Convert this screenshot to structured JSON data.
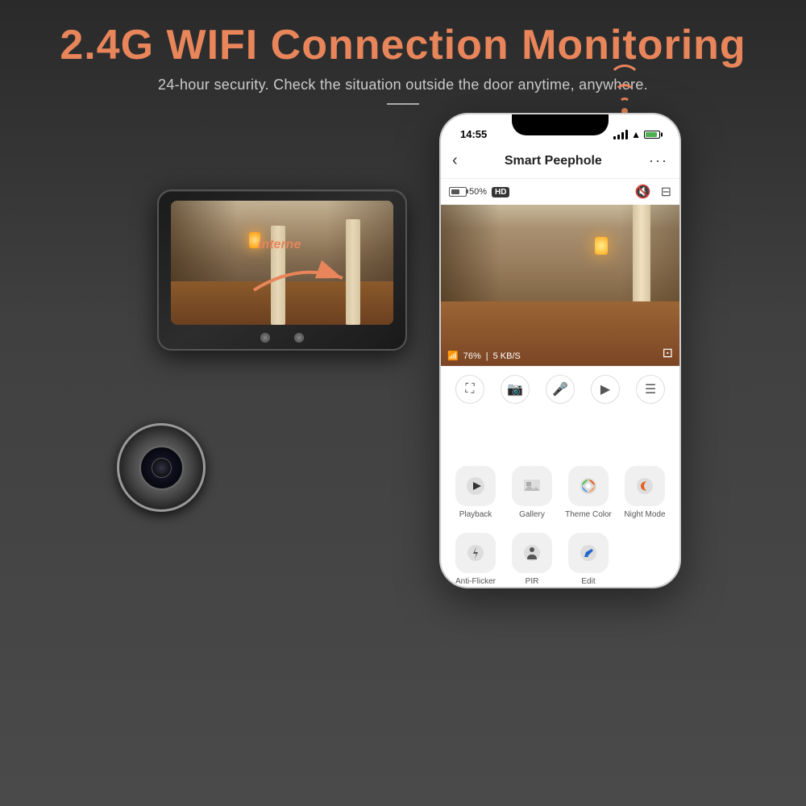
{
  "header": {
    "main_title": "2.4G WIFI Connection Monitoring",
    "subtitle": "24-hour security. Check the situation outside the door anytime, anywhere."
  },
  "arrow_label": "interne",
  "phone": {
    "status_time": "14:55",
    "app_title": "Smart Peephole",
    "battery_percent": "50%",
    "hd_label": "HD",
    "wifi_signal": "76%",
    "speed": "5 KB/S",
    "controls": {
      "fullscreen": "⛶",
      "camera": "📷",
      "mic": "🎤",
      "video": "▶",
      "menu": "☰"
    },
    "app_buttons": [
      {
        "label": "Playback",
        "icon": "▶",
        "style": "playback"
      },
      {
        "label": "Gallery",
        "icon": "🖼",
        "style": "gallery"
      },
      {
        "label": "Theme Color",
        "icon": "🎨",
        "style": "theme"
      },
      {
        "label": "Night Mode",
        "icon": "🌙",
        "style": "night"
      }
    ],
    "app_buttons_row2": [
      {
        "label": "Anti-Flicker",
        "icon": "⚡",
        "style": "flicker"
      },
      {
        "label": "PIR",
        "icon": "👤",
        "style": "pir"
      },
      {
        "label": "Edit",
        "icon": "✏",
        "style": "edit"
      }
    ]
  },
  "colors": {
    "accent": "#e8855a",
    "background": "#3a3a3a",
    "phone_bg": "#f5f5f5"
  }
}
